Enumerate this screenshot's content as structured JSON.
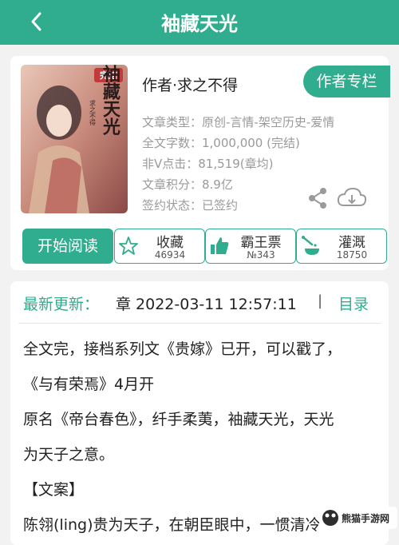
{
  "header": {
    "title": "袖藏天光"
  },
  "book": {
    "cover_badge": "完结",
    "cover_title": "袖藏天光",
    "cover_author": "求之不得",
    "author_line": "作者·求之不得",
    "author_column_label": "作者专栏",
    "meta": [
      "文章类型：原创-言情-架空历史-爱情",
      "全文字数：1,000,000 (完结)",
      "非Ⅴ点击：81,519(章均)",
      "文章积分：8.9亿",
      "签约状态：已签约"
    ]
  },
  "actions": {
    "read": "开始阅读",
    "collect": {
      "label": "收藏",
      "count": "46934"
    },
    "ticket": {
      "label": "霸王票",
      "count": "№343"
    },
    "water": {
      "label": "灌溉",
      "count": "18750"
    }
  },
  "update": {
    "label": "最新更新：",
    "chapter": "章 2022-03-11 12:57:11",
    "separator": "|",
    "toc": "目录"
  },
  "intro": {
    "lines": [
      "全文完，接档系列文《贵嫁》已开，可以戳了，",
      "《与有荣焉》4月开",
      "原名《帝台春色》，纤手柔荑，袖藏天光，天光",
      "为天子之意。",
      "【文案】",
      "陈翎(ling)贵为天子，在朝臣眼中，一惯清冷"
    ]
  },
  "watermark": {
    "text": "熊猫手游网"
  },
  "colors": {
    "accent": "#2fad8e",
    "meta_text": "#9a9a9a"
  }
}
